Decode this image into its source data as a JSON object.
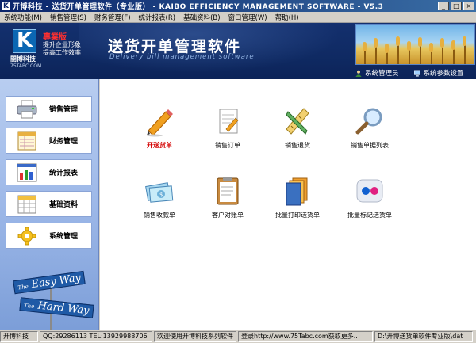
{
  "window": {
    "icon_letter": "K",
    "title": "开博科技 - 送货开单管理软件（专业版） - KAIBO EFFICIENCY MANAGEMENT SOFTWARE - V5.3"
  },
  "menubar": {
    "items": [
      "系统功能(M)",
      "销售管理(S)",
      "财务管理(F)",
      "统计报表(R)",
      "基础资料(B)",
      "窗口管理(W)",
      "帮助(H)"
    ]
  },
  "banner": {
    "logo_letter": "K",
    "logo_company": "開博科技",
    "logo_url": "75TABC.COM",
    "edition": "專業版",
    "slogan_line1": "提升企业形象",
    "slogan_line2": "提高工作效率",
    "heading": "送货开单管理软件",
    "heading_en": "Delivery bill management software",
    "link_admin": "系统管理员",
    "link_settings": "系统参数设置"
  },
  "leftnav": {
    "items": [
      {
        "label": "销售管理",
        "icon": "printer-icon"
      },
      {
        "label": "财务管理",
        "icon": "ledger-icon"
      },
      {
        "label": "统计报表",
        "icon": "bar-chart-icon"
      },
      {
        "label": "基础资料",
        "icon": "table-icon"
      },
      {
        "label": "系统管理",
        "icon": "gear-icon"
      }
    ],
    "sign_easy": "Easy Way",
    "sign_hard": "Hard Way",
    "sign_the": "The"
  },
  "main": {
    "tiles": [
      {
        "label": "开送货单",
        "icon": "pencil-icon"
      },
      {
        "label": "销售订单",
        "icon": "document-edit-icon"
      },
      {
        "label": "销售退货",
        "icon": "ruler-pencil-icon"
      },
      {
        "label": "销售单据列表",
        "icon": "magnifier-icon"
      },
      {
        "label": "销售收款单",
        "icon": "money-icon"
      },
      {
        "label": "客户对账单",
        "icon": "clipboard-icon"
      },
      {
        "label": "批量打印送货单",
        "icon": "folders-icon"
      },
      {
        "label": "批量标记送货单",
        "icon": "flickr-dots-icon"
      }
    ]
  },
  "statusbar": {
    "company": "开博科技",
    "contact": "QQ:29286113 TEL:13929988706",
    "welcome": "欢迎使用开博科技系列软件",
    "website": "登录http://www.75Tabc.com获取更多..",
    "path": "D:\\开博送货单软件专业版\\dat"
  },
  "colors": {
    "title_bar": "#0a246a",
    "banner": "#14306e",
    "left_nav": "#9db8e8",
    "highlight_label": "#d40000"
  }
}
